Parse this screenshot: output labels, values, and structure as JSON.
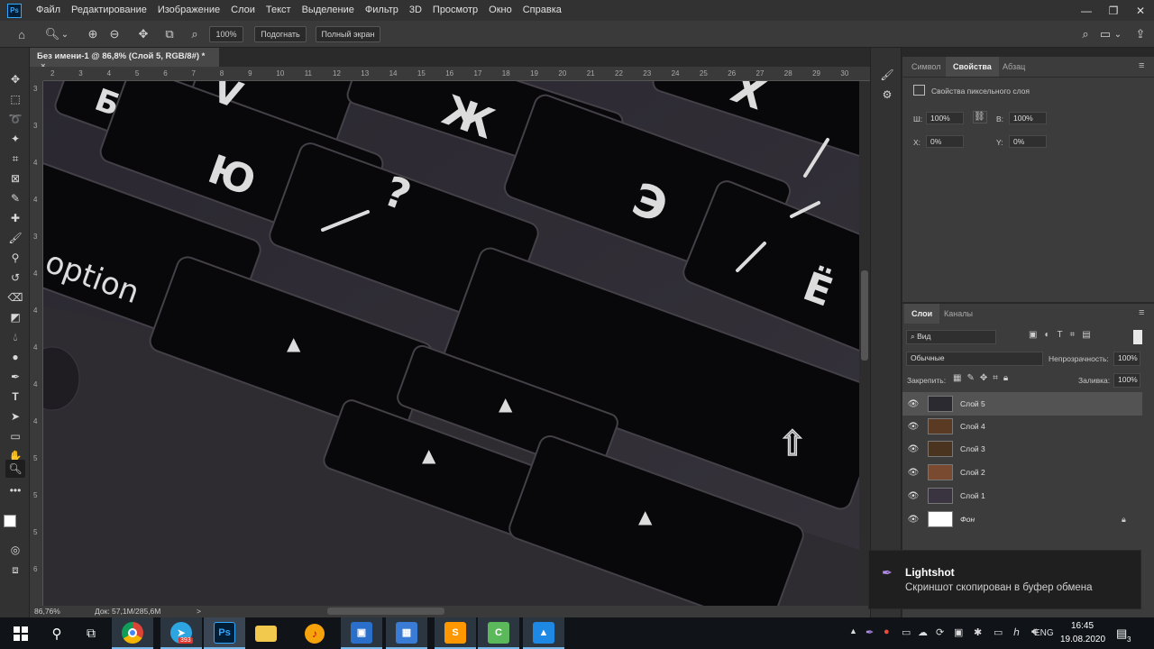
{
  "menu": {
    "logo": "Ps",
    "items": [
      "Файл",
      "Редактирование",
      "Изображение",
      "Слои",
      "Текст",
      "Выделение",
      "Фильтр",
      "3D",
      "Просмотр",
      "Окно",
      "Справка"
    ],
    "window_controls": [
      "—",
      "❐",
      "✕"
    ]
  },
  "options": {
    "zoom_value": "100%",
    "fit_button": "Подогнать",
    "fullscreen_button": "Полный экран",
    "zoom_icon_dropdown": "⌄"
  },
  "document": {
    "tab_title": "Без имени-1 @ 86,8% (Слой 5, RGB/8#) *",
    "tab_close": "×",
    "ruler_top": [
      "2",
      "3",
      "4",
      "5",
      "6",
      "7",
      "8",
      "9",
      "10",
      "11",
      "12",
      "13",
      "14",
      "15",
      "16",
      "17",
      "18",
      "19",
      "20",
      "21",
      "22",
      "23",
      "24",
      "25",
      "26",
      "27",
      "28",
      "29",
      "30"
    ],
    "ruler_left": [
      "3",
      "3",
      "4",
      "4",
      "3",
      "4",
      "4",
      "4",
      "4",
      "4",
      "5",
      "5",
      "5",
      "6"
    ],
    "zoom_status": "86,76%",
    "doc_status": "Док: 57,1M/285,6M",
    "status_arrow": ">"
  },
  "keyboard_glyphs": {
    "k1": "Б",
    "k2": "V",
    "k3": "Ж",
    "k4": "X",
    "k5": "Ю",
    "k6": "?",
    "k7": "Э",
    "k8": "Ё",
    "option": "option",
    "arrow_up": "▲",
    "arrow_left": "◀",
    "arrow_down": "▼",
    "return_icon": "⇧"
  },
  "properties": {
    "tabs": [
      "Символ",
      "Свойства",
      "Абзац"
    ],
    "selected_tab": 1,
    "title": "Свойства пиксельного слоя",
    "w_label": "Ш:",
    "w_value": "100%",
    "h_label": "В:",
    "h_value": "100%",
    "x_label": "X:",
    "x_value": "0%",
    "y_label": "Y:",
    "y_value": "0%"
  },
  "layers": {
    "tabs": [
      "Слои",
      "Каналы"
    ],
    "filter_label": "Вид",
    "blend_mode": "Обычные",
    "opacity_label": "Непрозрачность:",
    "opacity_value": "100%",
    "lock_label": "Закрепить:",
    "fill_label": "Заливка:",
    "fill_value": "100%",
    "items": [
      {
        "name": "Слой 5",
        "selected": true,
        "thumb_color": "#2a2a30"
      },
      {
        "name": "Слой 4",
        "selected": false,
        "thumb_color": "#5a3a22"
      },
      {
        "name": "Слой 3",
        "selected": false,
        "thumb_color": "#4a3420"
      },
      {
        "name": "Слой 2",
        "selected": false,
        "thumb_color": "#7a4a30"
      },
      {
        "name": "Слой 1",
        "selected": false,
        "thumb_color": "#3a3440"
      },
      {
        "name": "Фон",
        "selected": false,
        "thumb_color": "#ffffff",
        "italic": true,
        "locked": true
      }
    ]
  },
  "notification": {
    "app": "Lightshot",
    "message": "Скриншот скопирован в буфер обмена"
  },
  "taskbar": {
    "language": "ENG",
    "time": "16:45",
    "date": "19.08.2020",
    "notification_count": "3",
    "telegram_badge": "393",
    "ps_label": "Ps"
  },
  "colors": {
    "accent": "#31a8ff",
    "selected_layer": "#535353"
  }
}
